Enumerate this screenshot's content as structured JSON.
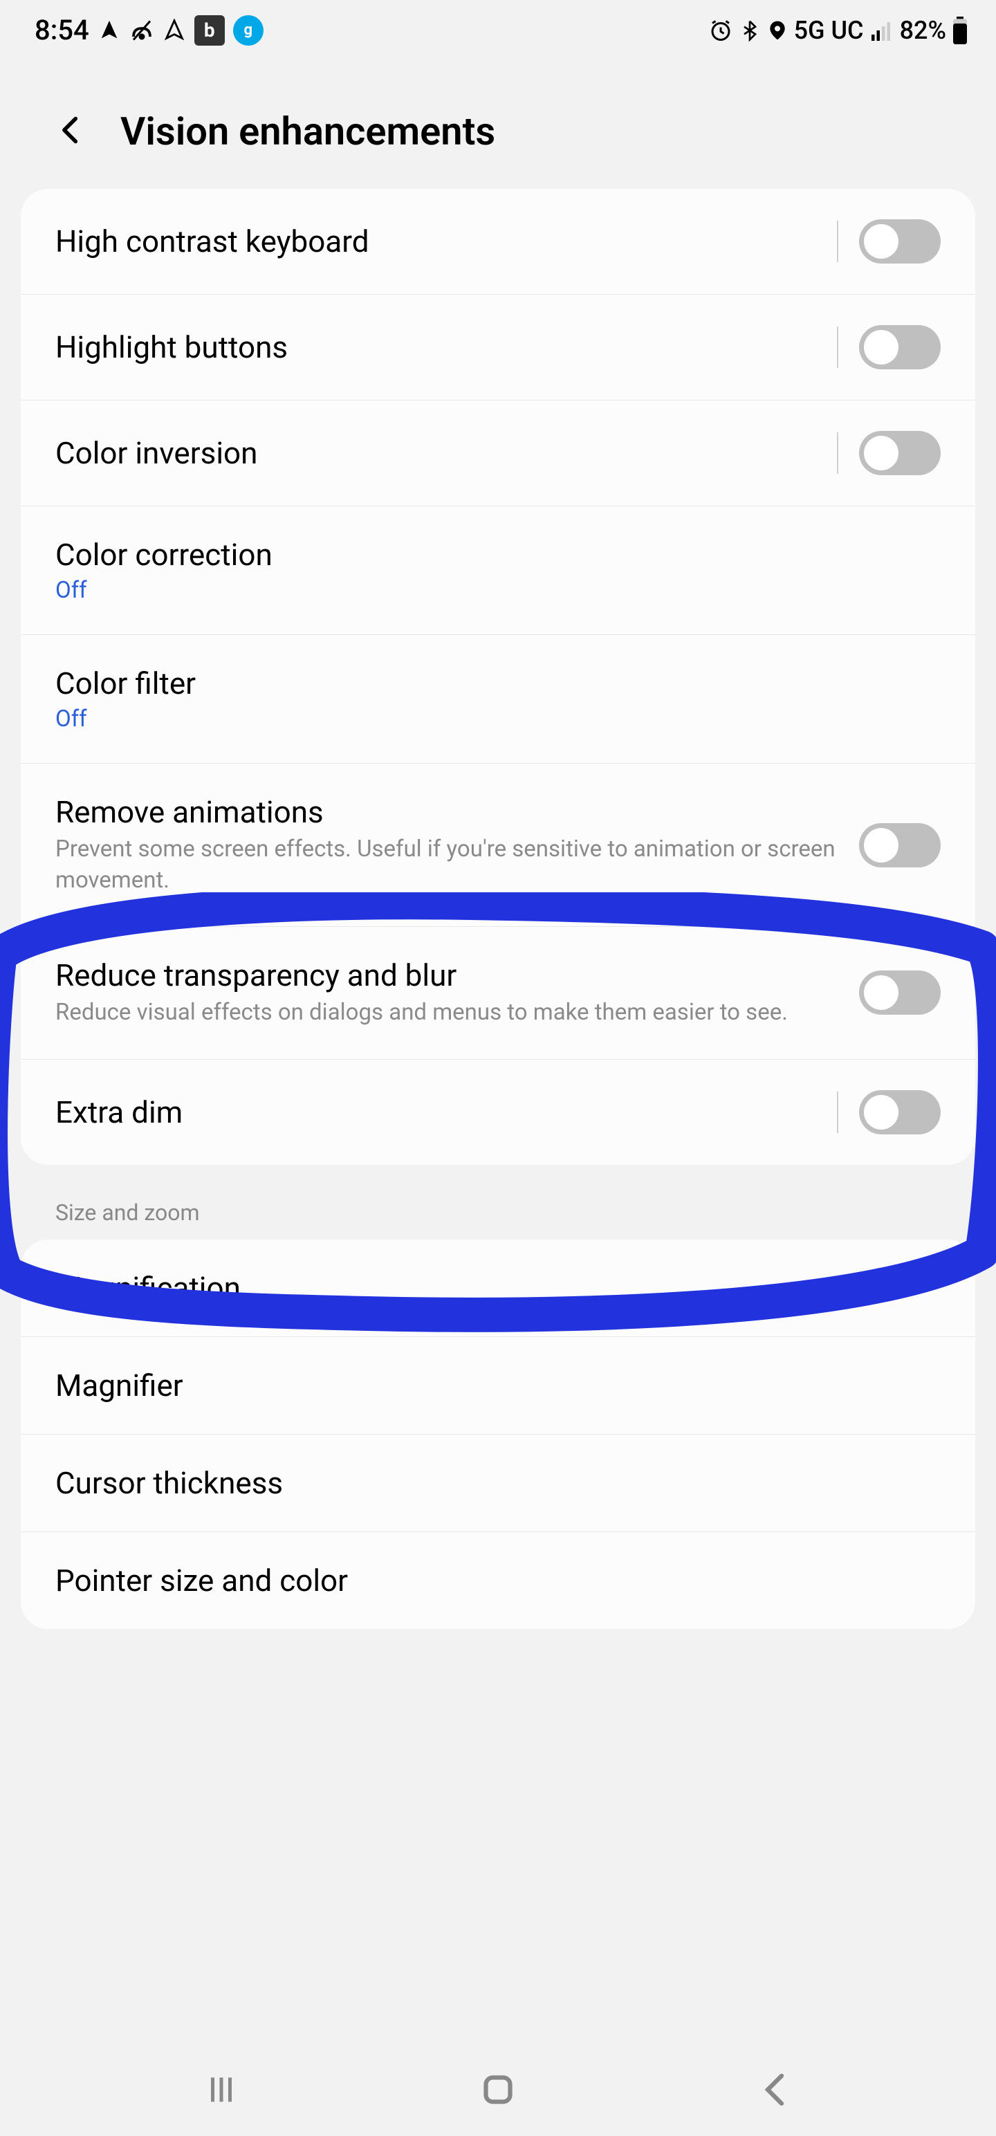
{
  "status": {
    "time": "8:54",
    "network": "5G UC",
    "battery": "82%"
  },
  "header": {
    "title": "Vision enhancements"
  },
  "settings": {
    "group1": [
      {
        "title": "High contrast keyboard",
        "toggle": true,
        "sep": true
      },
      {
        "title": "Highlight buttons",
        "toggle": true,
        "sep": true
      },
      {
        "title": "Color inversion",
        "toggle": true,
        "sep": true
      },
      {
        "title": "Color correction",
        "status": "Off"
      },
      {
        "title": "Color filter",
        "status": "Off"
      },
      {
        "title": "Remove animations",
        "sub": "Prevent some screen effects. Useful if you're sensitive to animation or screen movement.",
        "toggle": true
      },
      {
        "title": "Reduce transparency and blur",
        "sub": "Reduce visual effects on dialogs and menus to make them easier to see.",
        "toggle": true
      },
      {
        "title": "Extra dim",
        "toggle": true,
        "sep": true
      }
    ]
  },
  "sections": {
    "size_zoom": "Size and zoom"
  },
  "group2": [
    {
      "title": "Magnification"
    },
    {
      "title": "Magnifier"
    },
    {
      "title": "Cursor thickness"
    },
    {
      "title": "Pointer size and color"
    }
  ]
}
